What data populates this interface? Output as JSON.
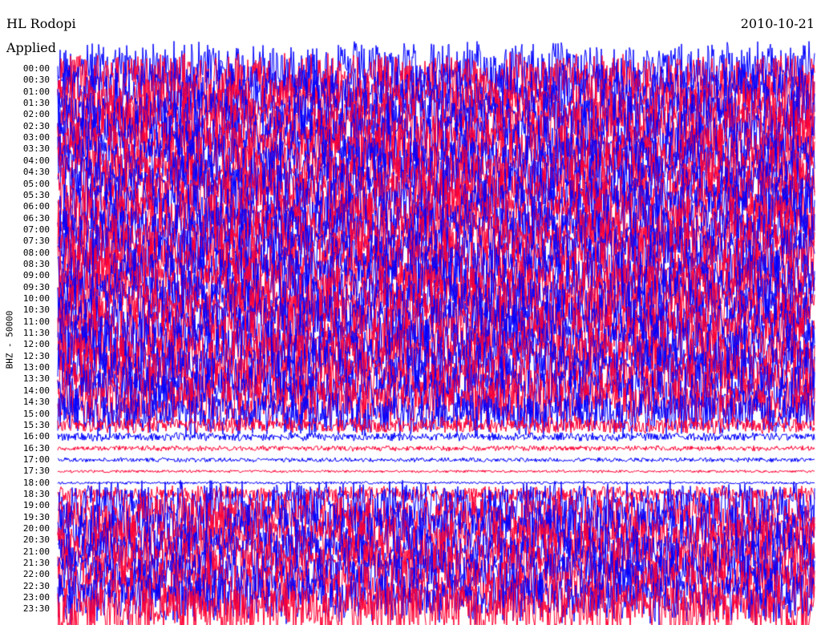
{
  "header": {
    "station": "HL Rodopi",
    "subtitle": "Applied",
    "date": "2010-10-21"
  },
  "colors": {
    "trace_a": "#0000ff",
    "trace_b": "#ff0033",
    "background": "#ffffff"
  },
  "chart_data": {
    "type": "line",
    "title": "HL Rodopi",
    "ylabel": "BHZ - 50000",
    "y_tick_labels": [
      "00:00",
      "00:30",
      "01:00",
      "01:30",
      "02:00",
      "02:30",
      "03:00",
      "03:30",
      "04:00",
      "04:30",
      "05:00",
      "05:30",
      "06:00",
      "06:30",
      "07:00",
      "07:30",
      "08:00",
      "08:30",
      "09:00",
      "09:30",
      "10:00",
      "10:30",
      "11:00",
      "11:30",
      "12:00",
      "12:30",
      "13:00",
      "13:30",
      "14:00",
      "14:30",
      "15:00",
      "15:30",
      "16:00",
      "16:30",
      "17:00",
      "17:30",
      "18:00",
      "18:30",
      "19:00",
      "19:30",
      "20:00",
      "20:30",
      "21:00",
      "21:30",
      "22:00",
      "22:30",
      "23:00",
      "23:30"
    ],
    "series": [
      {
        "color": "#0000ff",
        "rows": "odd"
      },
      {
        "color": "#ff0033",
        "rows": "even"
      }
    ],
    "row_amplitude": {
      "00:00": 1.0,
      "13:30": 0.9,
      "15:00": 0.8,
      "15:30": 0.3,
      "16:00": 0.15,
      "16:30": 0.1,
      "17:00": 0.08,
      "17:30": 0.05,
      "18:00": 0.05,
      "18:30": 0.3,
      "19:00": 0.9,
      "23:30": 1.0
    }
  }
}
